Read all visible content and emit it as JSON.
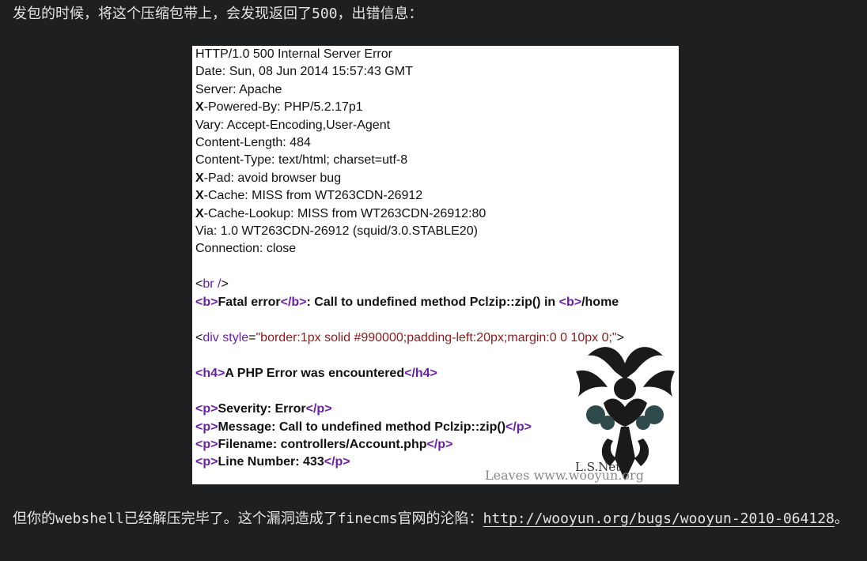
{
  "intro": {
    "text_before": "发包的时候，将这个压缩包带上，会发现返回了",
    "code": "500",
    "text_after": "，出错信息："
  },
  "screenshot": {
    "headers": [
      {
        "lead": "",
        "rest": "HTTP/1.0 500 Internal Server Error"
      },
      {
        "lead": "",
        "rest": "Date: Sun, 08 Jun 2014 15:57:43 GMT"
      },
      {
        "lead": "",
        "rest": "Server: Apache"
      },
      {
        "lead": "X",
        "rest": "-Powered-By: PHP/5.2.17p1"
      },
      {
        "lead": "",
        "rest": "Vary: Accept-Encoding,User-Agent"
      },
      {
        "lead": "",
        "rest": "Content-Length: 484"
      },
      {
        "lead": "",
        "rest": "Content-Type: text/html; charset=utf-8"
      },
      {
        "lead": "X",
        "rest": "-Pad: avoid browser bug"
      },
      {
        "lead": "X",
        "rest": "-Cache: MISS from WT263CDN-26912"
      },
      {
        "lead": "X",
        "rest": "-Cache-Lookup: MISS from WT263CDN-26912:80"
      },
      {
        "lead": "",
        "rest": "Via: 1.0 WT263CDN-26912 (squid/3.0.STABLE20)"
      },
      {
        "lead": "",
        "rest": "Connection: close"
      }
    ],
    "br_line": {
      "open": "<",
      "tag": "br /",
      "close": ">"
    },
    "fatal_line": {
      "open_b": "<b>",
      "label": "Fatal error",
      "close_b": "</b>",
      "message": ":  Call to undefined method Pclzip::zip() in ",
      "open_b2": "<b>",
      "path": "/home"
    },
    "div_line": {
      "lt": "<",
      "tag": "div",
      "attr": " style",
      "eq": "=",
      "value": "\"border:1px solid #990000;padding-left:20px;margin:0 0 10px 0;\"",
      "gt": ">"
    },
    "h4_line": {
      "open": "<h4>",
      "text": "A PHP Error was encountered",
      "close": "</h4>"
    },
    "p_lines": [
      {
        "text": "Severity: Error"
      },
      {
        "text": "Message:  Call to undefined method Pclzip::zip()"
      },
      {
        "text": "Filename: controllers/Account.php"
      },
      {
        "text": "Line Number: 433"
      }
    ],
    "p_open": "<p>",
    "p_close": "</p>",
    "watermark_top": "L.S.Net",
    "watermark_bottom": "Leaves  www.wooyun.org"
  },
  "outro": {
    "text_before": "但你的",
    "code1": "webshell",
    "text_mid1": "已经解压完毕了。这个漏洞造成了",
    "code2": "finecms",
    "text_mid2": "官网的沦陷：",
    "link": "http://wooyun.org/bugs/wooyun-2010-064128",
    "text_after": "。"
  }
}
